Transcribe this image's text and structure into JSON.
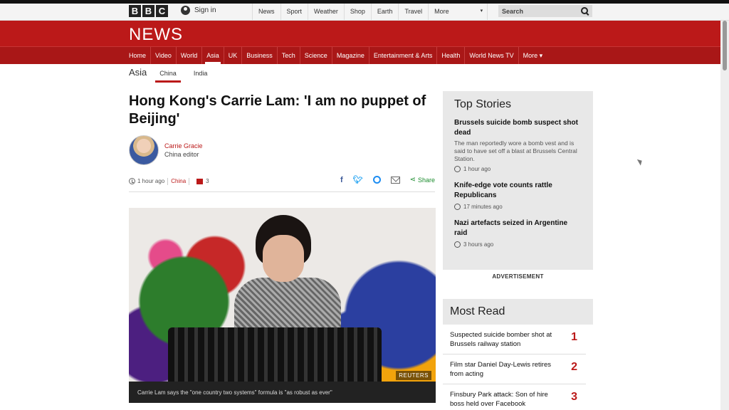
{
  "bbc_bar": {
    "logo_letters": [
      "B",
      "B",
      "C"
    ],
    "signin_label": "Sign in",
    "nav": [
      "News",
      "Sport",
      "Weather",
      "Shop",
      "Earth",
      "Travel"
    ],
    "more_label": "More",
    "search_placeholder": "Search"
  },
  "news_header": {
    "title": "NEWS",
    "nav": [
      "Home",
      "Video",
      "World",
      "Asia",
      "UK",
      "Business",
      "Tech",
      "Science",
      "Magazine",
      "Entertainment & Arts",
      "Health",
      "World News TV",
      "More ▾"
    ],
    "active": "Asia"
  },
  "subnav": {
    "section": "Asia",
    "items": [
      "China",
      "India"
    ],
    "active": "China"
  },
  "article": {
    "headline": "Hong Kong's Carrie Lam: 'I am no puppet of Beijing'",
    "author_name": "Carrie Gracie",
    "author_role": "China editor",
    "time": "1 hour ago",
    "topic": "China",
    "comment_count": "3",
    "share_label": "Share",
    "photo_credit": "REUTERS",
    "caption": "Carrie Lam says the \"one country two systems\" formula is \"as robust as ever\""
  },
  "top_stories": {
    "heading": "Top Stories",
    "items": [
      {
        "title": "Brussels suicide bomb suspect shot dead",
        "summary": "The man reportedly wore a bomb vest and is said to have set off a blast at Brussels Central Station.",
        "time": "1 hour ago"
      },
      {
        "title": "Knife-edge vote counts rattle Republicans",
        "summary": "",
        "time": "17 minutes ago"
      },
      {
        "title": "Nazi artefacts seized in Argentine raid",
        "summary": "",
        "time": "3 hours ago"
      }
    ]
  },
  "advertisement_label": "ADVERTISEMENT",
  "most_read": {
    "heading": "Most Read",
    "items": [
      {
        "title": "Suspected suicide bomber shot at Brussels railway station",
        "rank": "1"
      },
      {
        "title": "Film star Daniel Day-Lewis retires from acting",
        "rank": "2"
      },
      {
        "title": "Finsbury Park attack: Son of hire boss held over Facebook",
        "rank": "3"
      }
    ]
  }
}
